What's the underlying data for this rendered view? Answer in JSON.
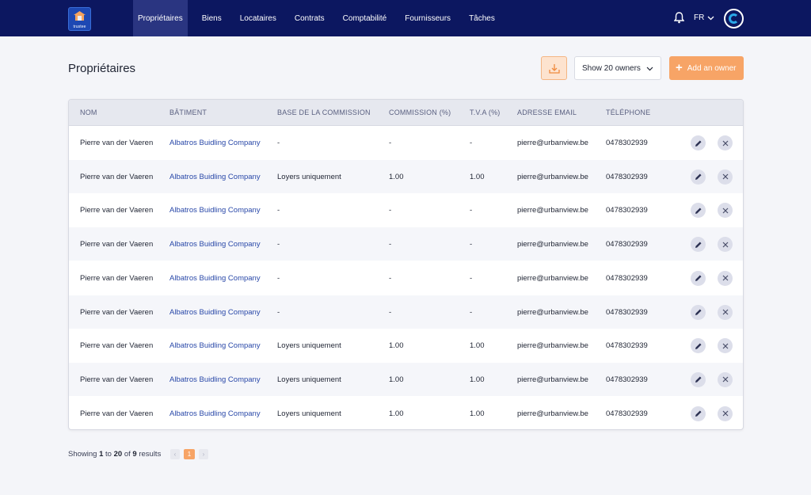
{
  "brand": {
    "logo_text": "trustee"
  },
  "nav": {
    "items": [
      "Propriétaires",
      "Biens",
      "Locataires",
      "Contrats",
      "Comptabilité",
      "Fournisseurs",
      "Tâches"
    ],
    "active_index": 0,
    "language": "FR"
  },
  "page": {
    "title": "Propriétaires",
    "page_size_select": "Show 20 owners",
    "add_button": "Add an owner"
  },
  "table": {
    "columns": [
      "NOM",
      "BÂTIMENT",
      "BASE DE LA COMMISSION",
      "COMMISSION (%)",
      "T.V.A (%)",
      "ADRESSE EMAIL",
      "TÉLÉPHONE"
    ],
    "rows": [
      [
        "Pierre van der Vaeren",
        "Albatros Buidling Company",
        "-",
        "-",
        "-",
        "pierre@urbanview.be",
        "0478302939"
      ],
      [
        "Pierre van der Vaeren",
        "Albatros Buidling Company",
        "Loyers uniquement",
        "1.00",
        "1.00",
        "pierre@urbanview.be",
        "0478302939"
      ],
      [
        "Pierre van der Vaeren",
        "Albatros Buidling Company",
        "-",
        "-",
        "-",
        "pierre@urbanview.be",
        "0478302939"
      ],
      [
        "Pierre van der Vaeren",
        "Albatros Buidling Company",
        "-",
        "-",
        "-",
        "pierre@urbanview.be",
        "0478302939"
      ],
      [
        "Pierre van der Vaeren",
        "Albatros Buidling Company",
        "-",
        "-",
        "-",
        "pierre@urbanview.be",
        "0478302939"
      ],
      [
        "Pierre van der Vaeren",
        "Albatros Buidling Company",
        "-",
        "-",
        "-",
        "pierre@urbanview.be",
        "0478302939"
      ],
      [
        "Pierre van der Vaeren",
        "Albatros Buidling Company",
        "Loyers uniquement",
        "1.00",
        "1.00",
        "pierre@urbanview.be",
        "0478302939"
      ],
      [
        "Pierre van der Vaeren",
        "Albatros Buidling Company",
        "Loyers uniquement",
        "1.00",
        "1.00",
        "pierre@urbanview.be",
        "0478302939"
      ],
      [
        "Pierre van der Vaeren",
        "Albatros Buidling Company",
        "Loyers uniquement",
        "1.00",
        "1.00",
        "pierre@urbanview.be",
        "0478302939"
      ]
    ]
  },
  "footer": {
    "showing": "Showing",
    "from": "1",
    "to_word": "to",
    "to": "20",
    "of_word": "of",
    "total": "9",
    "results_word": "results",
    "current_page": "1",
    "prev_glyph": "‹",
    "next_glyph": "›"
  },
  "colors": {
    "nav_bg": "#0c1760",
    "accent_orange": "#f7a466",
    "link_blue": "#2948a8"
  },
  "icons": [
    "trustee-logo-icon",
    "bell-icon",
    "chevron-down-icon",
    "user-avatar-icon",
    "download-icon",
    "plus-icon",
    "pencil-icon",
    "close-icon"
  ]
}
